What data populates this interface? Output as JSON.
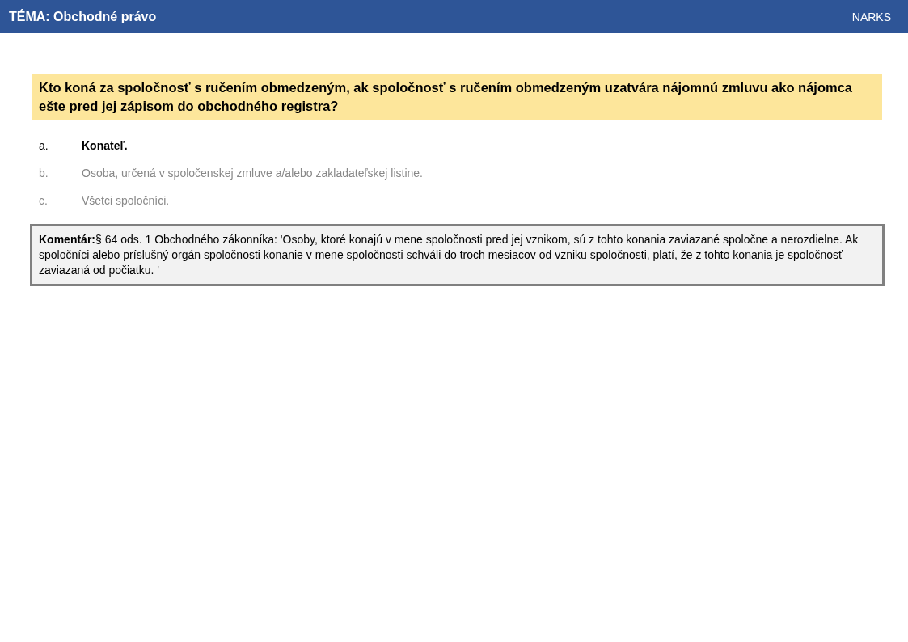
{
  "header": {
    "topic": "TÉMA: Obchodné právo",
    "brand": "NARKS"
  },
  "question": "Kto koná za spoločnosť s ručením obmedzeným, ak spoločnosť s ručením obmedzeným uzatvára nájomnú zmluvu ako nájomca ešte pred jej zápisom do obchodného registra?",
  "answers": [
    {
      "letter": "a.",
      "text": "Konateľ.",
      "correct": true
    },
    {
      "letter": "b.",
      "text": "Osoba, určená v spoločenskej zmluve a/alebo zakladateľskej listine.",
      "correct": false
    },
    {
      "letter": "c.",
      "text": "Všetci spoločníci.",
      "correct": false
    }
  ],
  "comment": "**Komentár:**§ 64 ods. 1 Obchodného zákonníka: 'Osoby, ktoré konajú v mene spoločnosti pred jej vznikom, sú z tohto konania zaviazané spoločne a nerozdielne. Ak spoločníci alebo príslušný orgán spoločnosti konanie v mene spoločnosti schváli do troch mesiacov od vzniku spoločnosti, platí, že z tohto konania je spoločnosť zaviazaná od počiatku. '"
}
